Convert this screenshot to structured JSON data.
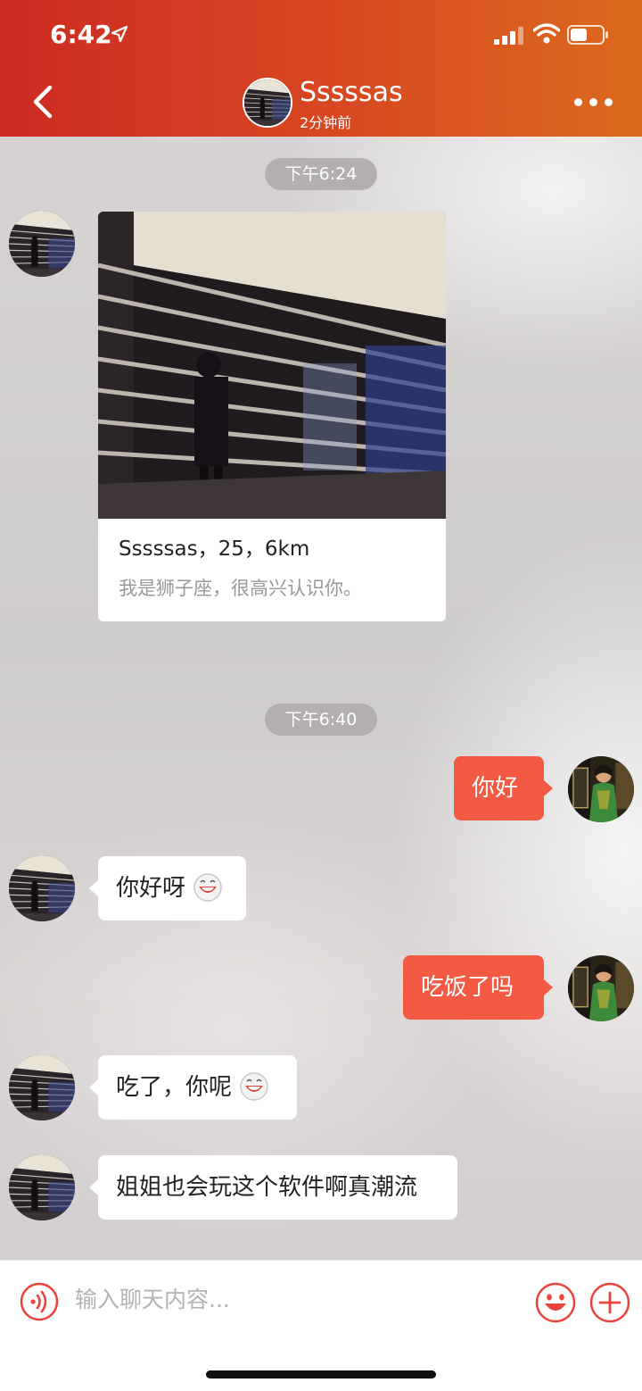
{
  "status_bar": {
    "time": "6:42"
  },
  "header": {
    "name": "Sssssas",
    "subtitle": "2分钟前"
  },
  "chat": {
    "time_1": "下午6:24",
    "card": {
      "title": "Sssssas，25，6km",
      "bio": "我是狮子座，很高兴认识你。"
    },
    "time_2": "下午6:40",
    "messages": [
      {
        "side": "out",
        "text": "你好"
      },
      {
        "side": "in",
        "text": "你好呀"
      },
      {
        "side": "out",
        "text": "吃饭了吗"
      },
      {
        "side": "in",
        "text": "吃了，你呢"
      },
      {
        "side": "in",
        "text": "姐姐也会玩这个软件啊真潮流"
      }
    ]
  },
  "input": {
    "placeholder": "输入聊天内容..."
  },
  "colors": {
    "header_start": "#cc2a22",
    "header_end": "#dc6a1d",
    "outgoing_bubble": "#f25a44",
    "accent": "#e8453c"
  },
  "icons": [
    "location-arrow-icon",
    "signal-icon",
    "wifi-icon",
    "battery-icon",
    "back-chevron-icon",
    "more-dots-icon",
    "grin-emoji-icon",
    "voice-icon",
    "emoji-icon",
    "plus-icon"
  ]
}
